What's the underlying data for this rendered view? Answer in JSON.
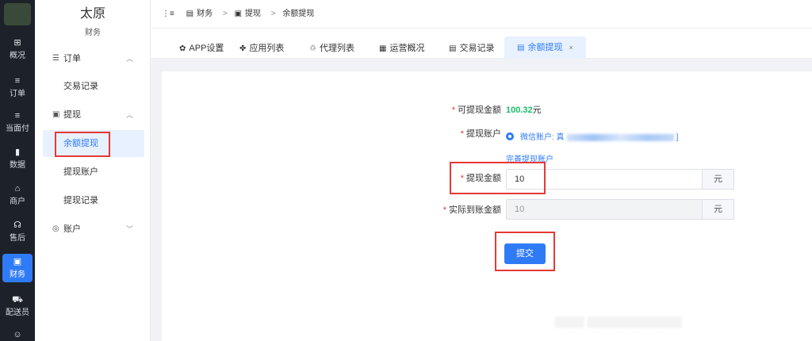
{
  "rail": {
    "items": [
      {
        "icon": "⊞",
        "label": "概况"
      },
      {
        "icon": "≡",
        "label": "订单"
      },
      {
        "icon": "≡",
        "label": "当面付"
      },
      {
        "icon": "▮",
        "label": "数据"
      },
      {
        "icon": "⌂",
        "label": "商户"
      },
      {
        "icon": "☊",
        "label": "售后"
      },
      {
        "icon": "▣",
        "label": "财务"
      },
      {
        "icon": "⛟",
        "label": "配送员"
      },
      {
        "icon": "☺",
        "label": ""
      }
    ]
  },
  "brand": {
    "name": "太原",
    "sub": "财务"
  },
  "subnav": {
    "order_group": "订单",
    "order_items": [
      "交易记录"
    ],
    "withdraw_group": "提现",
    "withdraw_items": [
      "余额提现",
      "提现账户",
      "提现记录"
    ],
    "account_group": "账户"
  },
  "breadcrumb": {
    "items": [
      "财务",
      "提现",
      "余额提现"
    ],
    "separator": ">"
  },
  "tabs": [
    {
      "icon": "✿",
      "label": "APP设置"
    },
    {
      "icon": "✤",
      "label": "应用列表"
    },
    {
      "icon": "♲",
      "label": "代理列表"
    },
    {
      "icon": "▦",
      "label": "运营概况"
    },
    {
      "icon": "▤",
      "label": "交易记录"
    },
    {
      "icon": "▤",
      "label": "余额提现",
      "close": "×"
    }
  ],
  "form": {
    "available_label": "可提现金额",
    "available_value": "100.32",
    "available_unit": "元",
    "account_label": "提现账户",
    "account_text": "微信账户: 真",
    "account_suffix": "]",
    "complete_link": "完善提现账户",
    "amount_label": "提现金额",
    "amount_value": "10",
    "amount_unit": "元",
    "actual_label": "实际到账金额",
    "actual_value": "10",
    "actual_unit": "元",
    "submit_label": "提交"
  },
  "colors": {
    "accent": "#2f7bf6",
    "highlight": "#e53935",
    "money": "#19be6b",
    "rail": "#1d2129"
  }
}
